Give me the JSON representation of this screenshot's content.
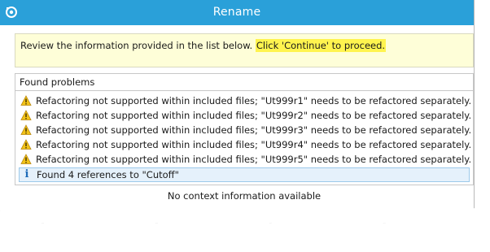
{
  "window": {
    "title": "Rename",
    "app_icon": "refactor-app-icon"
  },
  "info_banner": {
    "text": "Review the information provided in the list below. ",
    "highlight": "Click 'Continue' to proceed."
  },
  "problems": {
    "header": "Found problems",
    "items": [
      {
        "icon": "warning-icon",
        "text": "Refactoring not supported within included files; \"Ut999r1\" needs to be refactored separately."
      },
      {
        "icon": "warning-icon",
        "text": "Refactoring not supported within included files; \"Ut999r2\" needs to be refactored separately."
      },
      {
        "icon": "warning-icon",
        "text": "Refactoring not supported within included files; \"Ut999r3\" needs to be refactored separately."
      },
      {
        "icon": "warning-icon",
        "text": "Refactoring not supported within included files; \"Ut999r4\" needs to be refactored separately."
      },
      {
        "icon": "warning-icon",
        "text": "Refactoring not supported within included files; \"Ut999r5\" needs to be refactored separately."
      }
    ],
    "selected_item": {
      "icon": "info-icon",
      "glyph": "i",
      "text": "Found 4 references to \"Cutoff\""
    }
  },
  "context": {
    "text": "No context information available"
  },
  "colors": {
    "titlebar": "#2aa0d9",
    "banner": "#fefed8",
    "highlight": "#fff44f",
    "selection": "#e5f1fb"
  }
}
